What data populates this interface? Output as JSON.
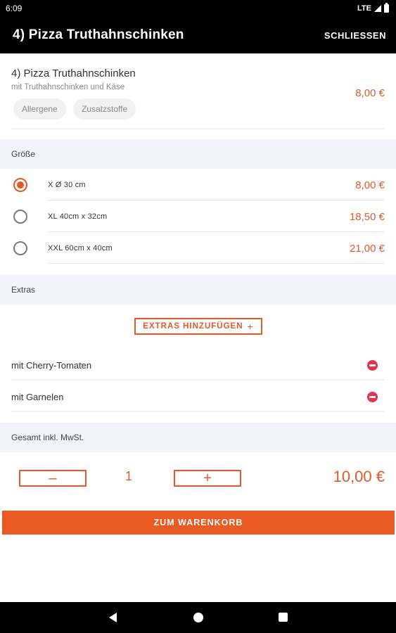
{
  "status_bar": {
    "time": "6:09",
    "network": "LTE"
  },
  "app_bar": {
    "title": "4) Pizza Truthahnschinken",
    "close_label": "SCHLIESSEN"
  },
  "product": {
    "name": "4) Pizza Truthahnschinken",
    "description": "mit Truthahnschinken und Käse",
    "price": "8,00 €",
    "chips": [
      "Allergene",
      "Zusatzstoffe"
    ]
  },
  "size_section": {
    "title": "Größe",
    "options": [
      {
        "label": "X Ø 30 cm",
        "price": "8,00 €",
        "selected": true
      },
      {
        "label": "XL 40cm x 32cm",
        "price": "18,50 €",
        "selected": false
      },
      {
        "label": "XXL 60cm x 40cm",
        "price": "21,00 €",
        "selected": false
      }
    ]
  },
  "extras_section": {
    "title": "Extras",
    "add_button_label": "EXTRAS HINZUFÜGEN",
    "items": [
      {
        "label": "mit Cherry-Tomaten"
      },
      {
        "label": "mit Garnelen"
      }
    ]
  },
  "total_section": {
    "title": "Gesamt inkl. MwSt.",
    "quantity": "1",
    "minus_symbol": "–",
    "plus_symbol": "+",
    "total": "10,00 €"
  },
  "cart_button_label": "ZUM WARENKORB",
  "colors": {
    "accent": "#e8572a",
    "remove": "#e8314a",
    "cart_button": "#ec5a24",
    "section_bg": "#f2f4f7"
  },
  "icons": {
    "remove": "minus-circle-icon",
    "radio": "radio-icon",
    "nav": [
      "back-icon",
      "home-icon",
      "recents-icon"
    ]
  }
}
